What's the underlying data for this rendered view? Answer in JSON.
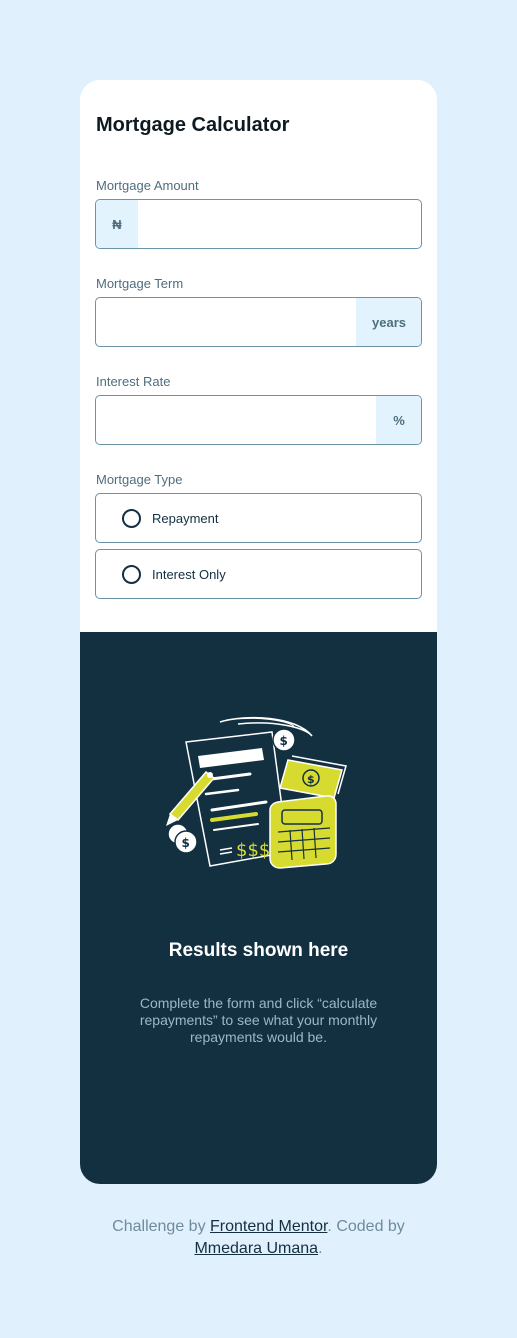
{
  "form": {
    "title": "Mortgage Calculator",
    "amount": {
      "label": "Mortgage Amount",
      "prefix": "₦",
      "value": ""
    },
    "term": {
      "label": "Mortgage Term",
      "suffix": "years",
      "value": ""
    },
    "rate": {
      "label": "Interest Rate",
      "suffix": "%",
      "value": ""
    },
    "type": {
      "label": "Mortgage Type",
      "options": [
        "Repayment",
        "Interest Only"
      ]
    }
  },
  "results": {
    "illustration_icon": "calculator-illustration-icon",
    "title": "Results shown here",
    "text": "Complete the form and click “calculate repayments” to see what your monthly repayments would be."
  },
  "footer": {
    "prefix": "Challenge by ",
    "link1": "Frontend Mentor",
    "middle": ". Coded by ",
    "link2": "Mmedara Umana",
    "suffix": "."
  },
  "colors": {
    "background": "#e0f0fc",
    "slate_900": "#133041",
    "lime": "#d8db2f",
    "border": "#6b94a8"
  }
}
